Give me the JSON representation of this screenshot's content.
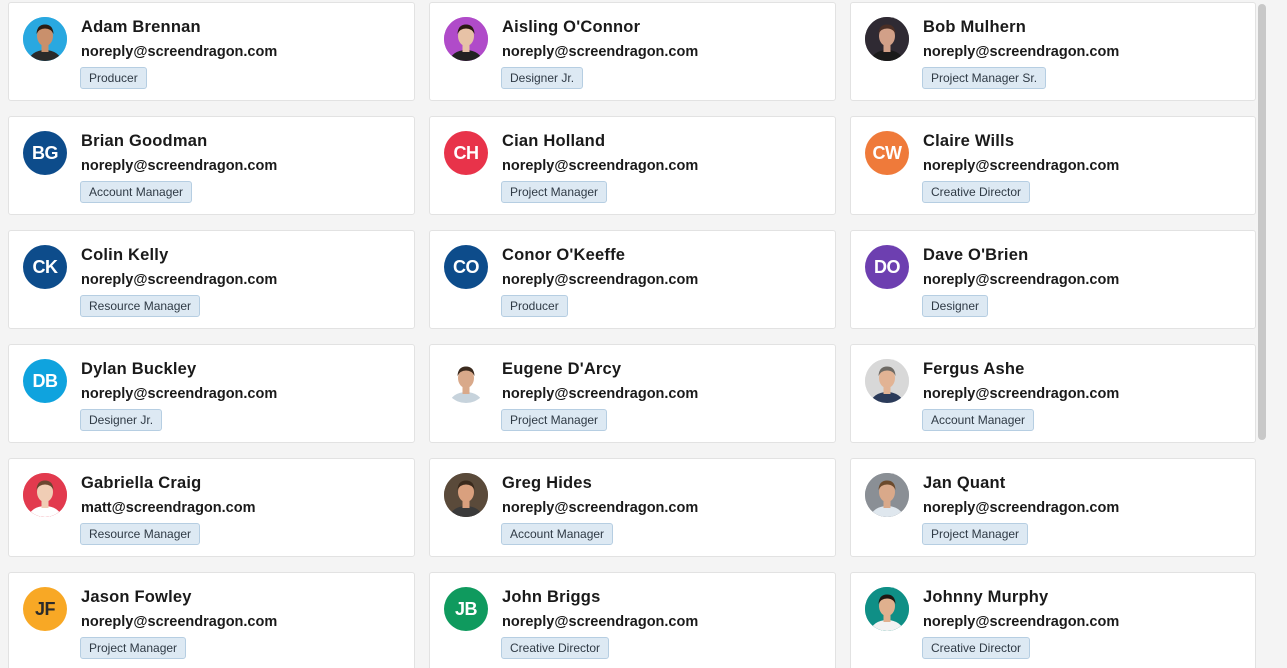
{
  "people": [
    {
      "name": "Adam Brennan",
      "email": "noreply@screendragon.com",
      "role": "Producer",
      "avatar": {
        "type": "photo",
        "bg": "#29a8e0",
        "skin": "#c9906c",
        "hair": "#2b1d14",
        "shirt": "#2a2a2a"
      }
    },
    {
      "name": "Aisling O'Connor",
      "email": "noreply@screendragon.com",
      "role": "Designer Jr.",
      "avatar": {
        "type": "photo",
        "bg": "#b04bc9",
        "skin": "#e7c2a6",
        "hair": "#2a1a12",
        "shirt": "#222222"
      }
    },
    {
      "name": "Bob Mulhern",
      "email": "noreply@screendragon.com",
      "role": "Project Manager Sr.",
      "avatar": {
        "type": "photo",
        "bg": "#2f2a33",
        "skin": "#d2a088",
        "hair": "#4a2e25",
        "shirt": "#1a1a1a"
      }
    },
    {
      "name": "Brian Goodman",
      "email": "noreply@screendragon.com",
      "role": "Account Manager",
      "avatar": {
        "type": "initials",
        "initials": "BG",
        "bg": "#0d4c8b"
      }
    },
    {
      "name": "Cian Holland",
      "email": "noreply@screendragon.com",
      "role": "Project Manager",
      "avatar": {
        "type": "initials",
        "initials": "CH",
        "bg": "#e8334a"
      }
    },
    {
      "name": "Claire Wills",
      "email": "noreply@screendragon.com",
      "role": "Creative Director",
      "avatar": {
        "type": "initials",
        "initials": "CW",
        "bg": "#ef7a3a"
      }
    },
    {
      "name": "Colin Kelly",
      "email": "noreply@screendragon.com",
      "role": "Resource Manager",
      "avatar": {
        "type": "initials",
        "initials": "CK",
        "bg": "#0d4c8b"
      }
    },
    {
      "name": "Conor O'Keeffe",
      "email": "noreply@screendragon.com",
      "role": "Producer",
      "avatar": {
        "type": "initials",
        "initials": "CO",
        "bg": "#0d4c8b"
      }
    },
    {
      "name": "Dave O'Brien",
      "email": "noreply@screendragon.com",
      "role": "Designer",
      "avatar": {
        "type": "initials",
        "initials": "DO",
        "bg": "#6d3fb0"
      }
    },
    {
      "name": "Dylan Buckley",
      "email": "noreply@screendragon.com",
      "role": "Designer Jr.",
      "avatar": {
        "type": "initials",
        "initials": "DB",
        "bg": "#0fa3de"
      }
    },
    {
      "name": "Eugene D'Arcy",
      "email": "noreply@screendragon.com",
      "role": "Project Manager",
      "avatar": {
        "type": "photo",
        "bg": "#ffffff",
        "skin": "#d9a98a",
        "hair": "#3b2a1e",
        "shirt": "#c7d3dc"
      }
    },
    {
      "name": "Fergus Ashe",
      "email": "noreply@screendragon.com",
      "role": "Account Manager",
      "avatar": {
        "type": "photo",
        "bg": "#d8d8d8",
        "skin": "#e2b394",
        "hair": "#6e6a64",
        "shirt": "#2b3b5a"
      }
    },
    {
      "name": "Gabriella Craig",
      "email": "matt@screendragon.com",
      "role": "Resource Manager",
      "avatar": {
        "type": "photo",
        "bg": "#e23a4e",
        "skin": "#f0cdb5",
        "hair": "#6b4630",
        "shirt": "#ffffff"
      }
    },
    {
      "name": "Greg Hides",
      "email": "noreply@screendragon.com",
      "role": "Account Manager",
      "avatar": {
        "type": "photo",
        "bg": "#5a4a3a",
        "skin": "#d9a07e",
        "hair": "#3a2a1c",
        "shirt": "#3a3a3a"
      }
    },
    {
      "name": "Jan Quant",
      "email": "noreply@screendragon.com",
      "role": "Project Manager",
      "avatar": {
        "type": "photo",
        "bg": "#8a8f95",
        "skin": "#d9a98a",
        "hair": "#6b4a2c",
        "shirt": "#dfe7ee"
      }
    },
    {
      "name": "Jason Fowley",
      "email": "noreply@screendragon.com",
      "role": "Project Manager",
      "avatar": {
        "type": "initials",
        "initials": "JF",
        "bg": "#f8a825",
        "fg": "#2b2b2b"
      }
    },
    {
      "name": "John Briggs",
      "email": "noreply@screendragon.com",
      "role": "Creative Director",
      "avatar": {
        "type": "initials",
        "initials": "JB",
        "bg": "#0f9a5e"
      }
    },
    {
      "name": "Johnny Murphy",
      "email": "noreply@screendragon.com",
      "role": "Creative Director",
      "avatar": {
        "type": "photo",
        "bg": "#0f8f86",
        "skin": "#e0b08e",
        "hair": "#1f1712",
        "shirt": "#f2f2f2"
      }
    }
  ]
}
